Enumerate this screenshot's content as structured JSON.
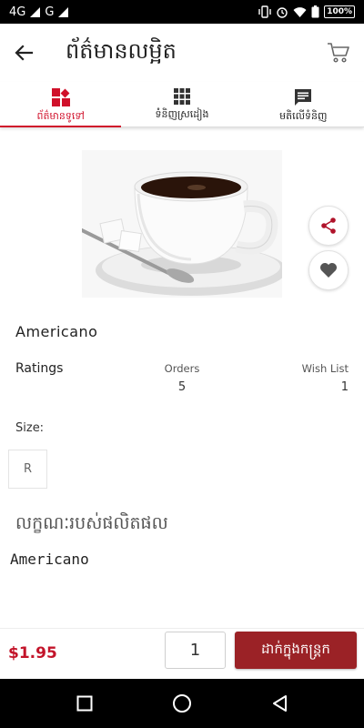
{
  "status_bar": {
    "network_1": "4G",
    "network_2": "G",
    "battery": "100%"
  },
  "app_bar": {
    "title": "ព័ត៌មានលម្អិត"
  },
  "tabs": [
    {
      "label": "ព័ត៌មានទូទៅ",
      "icon": "category-icon",
      "active": true
    },
    {
      "label": "ទំនិញស្រដៀង",
      "icon": "grid-icon",
      "active": false
    },
    {
      "label": "មតិលើទំនិញ",
      "icon": "comment-icon",
      "active": false
    }
  ],
  "product": {
    "name": "Americano",
    "ratings_label": "Ratings",
    "orders_label": "Orders",
    "orders_value": "5",
    "wishlist_label": "Wish List",
    "wishlist_value": "1",
    "size_label": "Size:",
    "sizes": [
      "R"
    ],
    "description_heading": "លក្ខណៈរបស់ផលិតផល",
    "description": "Americano"
  },
  "purchase": {
    "price": "$1.95",
    "quantity": "1",
    "add_to_cart_label": "ដាក់ក្នុងកន្ត្រក"
  },
  "colors": {
    "accent": "#d0102a",
    "price": "#c3142a",
    "button": "#9b2226"
  }
}
